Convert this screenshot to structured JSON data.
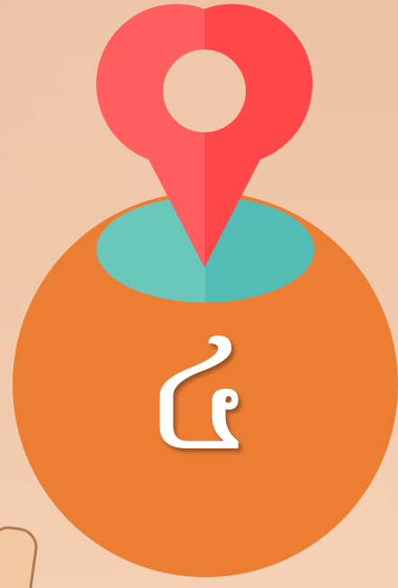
{
  "colors": {
    "background": "#efc6a8",
    "badge_circle": "#ec7e33",
    "teal_ellipse_left": "#69c7bb",
    "teal_ellipse_right": "#52bdb5",
    "pin_left": "#ff5e5e",
    "pin_right": "#ff4648",
    "pin_hole": "#efc8ac",
    "numeral": "#ffffff"
  },
  "icons": {
    "pin": "map-pin-icon"
  },
  "numeral": "៤"
}
